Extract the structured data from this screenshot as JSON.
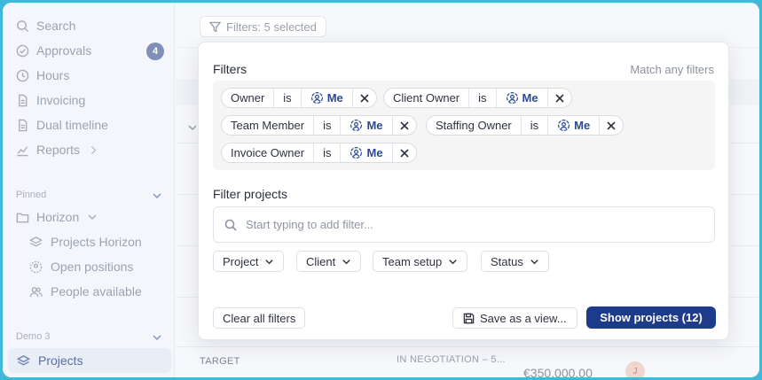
{
  "sidebar": {
    "items": [
      {
        "label": "Search",
        "icon": "search-icon"
      },
      {
        "label": "Approvals",
        "icon": "check-circle-icon",
        "badge": "4"
      },
      {
        "label": "Hours",
        "icon": "clock-icon"
      },
      {
        "label": "Invoicing",
        "icon": "document-icon"
      },
      {
        "label": "Dual timeline",
        "icon": "document-icon"
      },
      {
        "label": "Reports",
        "icon": "chart-icon"
      }
    ],
    "pinned_label": "Pinned",
    "pinned_group": "Horizon",
    "pinned_items": [
      "Projects Horizon",
      "Open positions",
      "People available"
    ],
    "demo_label": "Demo 3",
    "active_item": "Projects"
  },
  "main": {
    "filter_trigger": "Filters: 5 selected",
    "bg_row": {
      "target": "TARGET",
      "status": "IN NEGOTIATION – 5...",
      "amount": "€350,000.00",
      "avatar": "J"
    }
  },
  "popover": {
    "title": "Filters",
    "match_mode": "Match any filters",
    "chips": [
      {
        "field": "Owner",
        "op": "is",
        "value": "Me"
      },
      {
        "field": "Client Owner",
        "op": "is",
        "value": "Me"
      },
      {
        "field": "Team Member",
        "op": "is",
        "value": "Me"
      },
      {
        "field": "Staffing Owner",
        "op": "is",
        "value": "Me"
      },
      {
        "field": "Invoice Owner",
        "op": "is",
        "value": "Me"
      }
    ],
    "filter_projects_title": "Filter projects",
    "search_placeholder": "Start typing to add filter...",
    "dropdowns": [
      "Project",
      "Client",
      "Team setup",
      "Status"
    ],
    "clear_label": "Clear all filters",
    "save_label": "Save as a view...",
    "show_label": "Show projects (12)"
  },
  "colors": {
    "primary": "#1e3a8a",
    "accent_text": "#2c4a92",
    "badge": "#7f8fb8"
  }
}
